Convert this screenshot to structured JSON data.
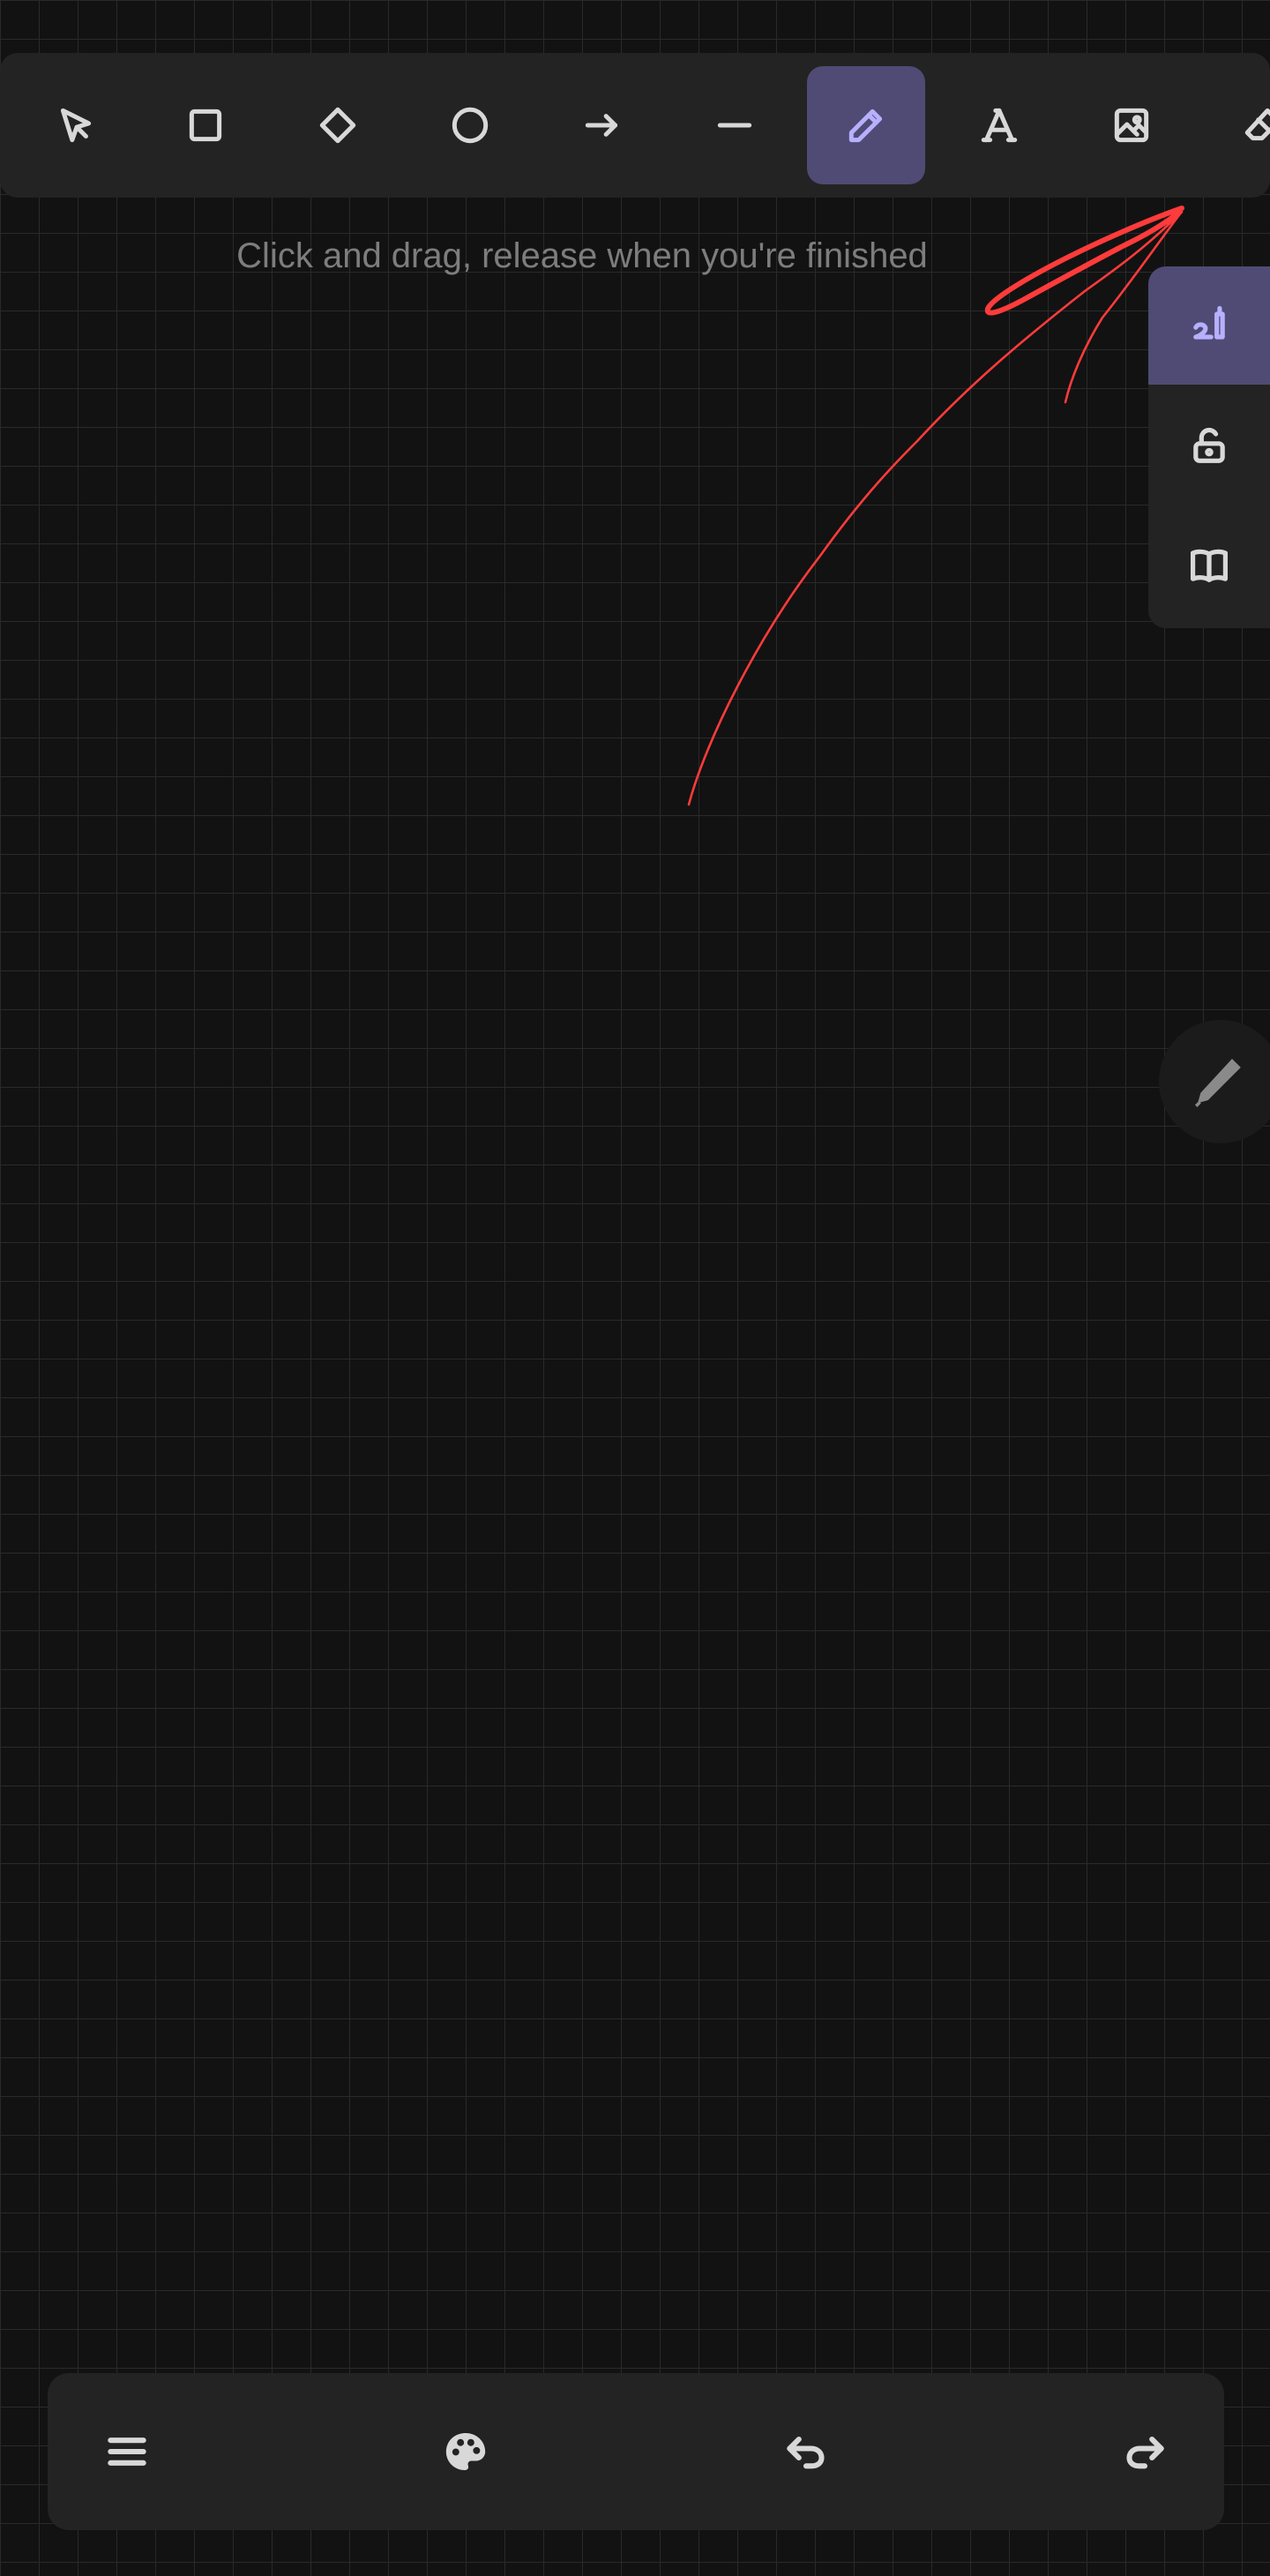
{
  "canvas": {
    "hint_text": "Click and drag, release when you're finished",
    "stroke_color": "#ff3b3b"
  },
  "toolbar": {
    "tools": [
      {
        "name": "selection",
        "icon": "cursor-arrow-icon",
        "active": false
      },
      {
        "name": "rectangle",
        "icon": "square-icon",
        "active": false
      },
      {
        "name": "diamond",
        "icon": "diamond-icon",
        "active": false
      },
      {
        "name": "ellipse",
        "icon": "circle-icon",
        "active": false
      },
      {
        "name": "arrow",
        "icon": "arrow-right-icon",
        "active": false
      },
      {
        "name": "line",
        "icon": "line-icon",
        "active": false
      },
      {
        "name": "draw",
        "icon": "pencil-icon",
        "active": true
      },
      {
        "name": "text",
        "icon": "text-a-icon",
        "active": false
      },
      {
        "name": "image",
        "icon": "image-icon",
        "active": false
      },
      {
        "name": "eraser",
        "icon": "eraser-icon",
        "active": false
      }
    ],
    "active_color": "#4f4b74",
    "active_icon_color": "#b7b0ff"
  },
  "side_panel": {
    "buttons": [
      {
        "name": "stylus-mode",
        "icon": "stylus-icon",
        "active": true
      },
      {
        "name": "lock",
        "icon": "unlock-icon",
        "active": false
      },
      {
        "name": "library",
        "icon": "book-icon",
        "active": false
      }
    ]
  },
  "floating": {
    "icon": "pencil-icon"
  },
  "bottom_bar": {
    "buttons": [
      {
        "name": "menu",
        "icon": "hamburger-menu-icon"
      },
      {
        "name": "colors",
        "icon": "palette-icon"
      },
      {
        "name": "undo",
        "icon": "undo-icon"
      },
      {
        "name": "redo",
        "icon": "redo-icon"
      }
    ]
  }
}
